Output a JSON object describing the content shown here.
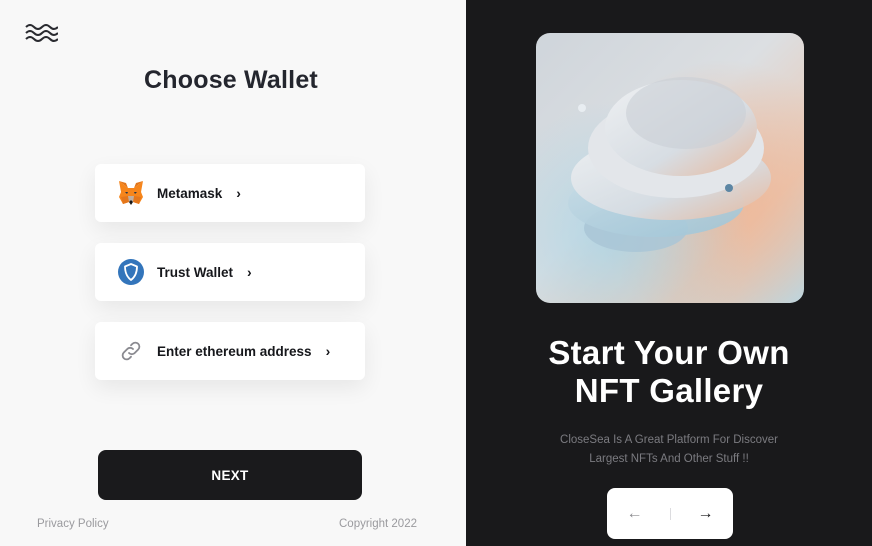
{
  "logo": {
    "icon": "waves-logo-icon"
  },
  "title": "Choose Wallet",
  "wallets": [
    {
      "label": "Metamask",
      "icon": "fox-icon",
      "chevron": "›"
    },
    {
      "label": "Trust Wallet",
      "icon": "shield-icon",
      "chevron": "›"
    },
    {
      "label": "Enter ethereum address",
      "icon": "link-icon",
      "chevron": "›"
    }
  ],
  "next_label": "NEXT",
  "footer": {
    "privacy": "Privacy Policy",
    "copyright": "Copyright 2022"
  },
  "promo": {
    "headline_line1": "Start Your Own",
    "headline_line2": "NFT Gallery",
    "desc_line1": "CloseSea Is A Great Platform For Discover",
    "desc_line2": "Largest NFTs And Other Stuff !!"
  },
  "pager": {
    "prev": "←",
    "next": "→"
  },
  "colors": {
    "dark": "#19191b",
    "button": "#1a1a1c",
    "trust_blue": "#3375bb",
    "metamask_orange": "#e2761b"
  }
}
